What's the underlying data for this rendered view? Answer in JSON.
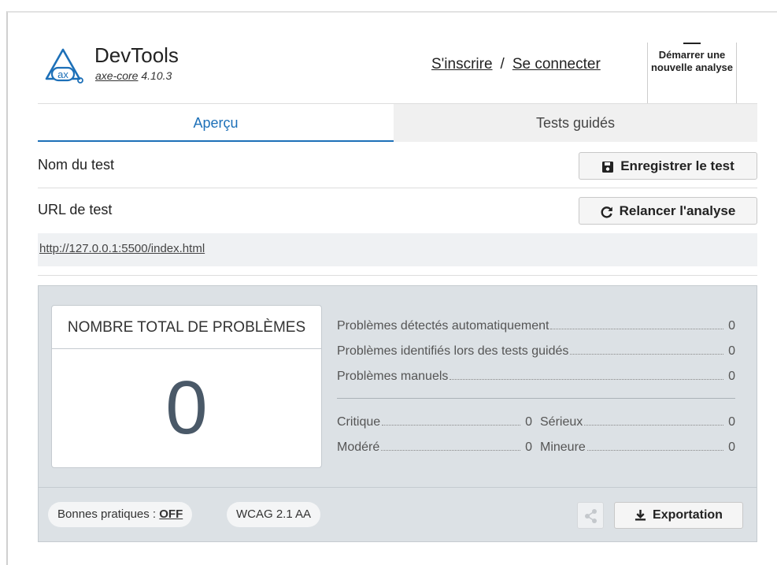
{
  "header": {
    "app_title": "DevTools",
    "engine_link": "axe-core",
    "engine_version": "4.10.3",
    "logo_text": "ax",
    "signup": "S'inscrire",
    "separator": "/",
    "login": "Se connecter",
    "new_scan": "Démarrer une nouvelle analyse"
  },
  "tabs": [
    {
      "label": "Aperçu",
      "active": true
    },
    {
      "label": "Tests guidés",
      "active": false
    }
  ],
  "test_name_label": "Nom du test",
  "save_button": "Enregistrer le test",
  "test_url_label": "URL de test",
  "rerun_button": "Relancer l'analyse",
  "test_url": "http://127.0.0.1:5500/index.html",
  "summary": {
    "total_title": "NOMBRE TOTAL DE PROBLÈMES",
    "total_value": "0",
    "issues": [
      {
        "label": "Problèmes détectés automatiquement",
        "value": "0"
      },
      {
        "label": "Problèmes identifiés lors des tests guidés",
        "value": "0"
      },
      {
        "label": "Problèmes manuels",
        "value": "0"
      }
    ],
    "severity": [
      {
        "label": "Critique",
        "value": "0"
      },
      {
        "label": "Sérieux",
        "value": "0"
      },
      {
        "label": "Modéré",
        "value": "0"
      },
      {
        "label": "Mineure",
        "value": "0"
      }
    ]
  },
  "footer": {
    "best_practices_label": "Bonnes pratiques :",
    "best_practices_value": "OFF",
    "standard": "WCAG 2.1 AA",
    "export_button": "Exportation"
  },
  "colors": {
    "accent": "#1d70b8",
    "panel_bg": "#dce1e5",
    "total_number": "#4a5968"
  },
  "icons": {
    "logo": "axe-logo-icon",
    "save": "floppy-disk-icon",
    "rerun": "refresh-icon",
    "share": "share-icon",
    "export": "download-icon"
  }
}
